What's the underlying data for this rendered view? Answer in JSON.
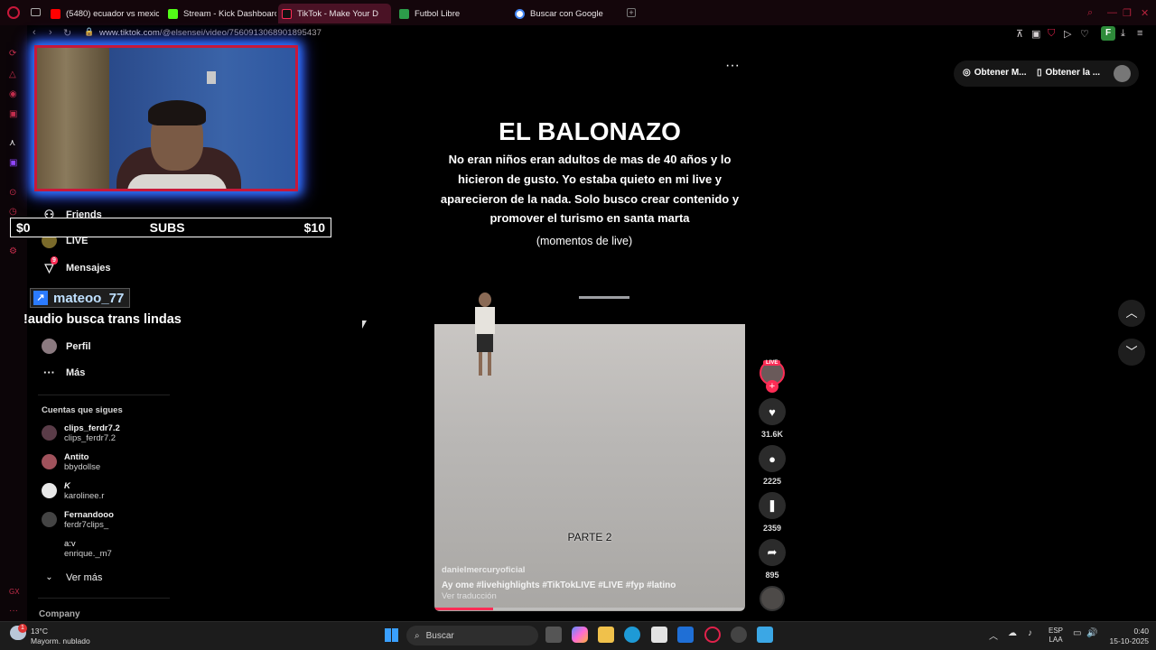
{
  "browser": {
    "tabs": [
      {
        "label": "(5480) ecuador vs mexico",
        "icon": "youtube-icon",
        "color": "#ff0000"
      },
      {
        "label": "Stream - Kick Dashboard",
        "icon": "kick-icon",
        "color": "#53fc18"
      },
      {
        "label": "TikTok - Make Your D",
        "icon": "tiktok-icon",
        "color": "#ffffff",
        "active": true
      },
      {
        "label": "Futbol Libre",
        "icon": "futbol-icon",
        "color": "#2c9c4a"
      },
      {
        "label": "Buscar con Google",
        "icon": "google-icon",
        "color": "#4285f4"
      }
    ],
    "url_host": "www.tiktok.com",
    "url_path": "/@elsensei/video/7560913068901895437",
    "profile_letter": "F"
  },
  "top_right": {
    "btn1": "Obtener M...",
    "btn2": "Obtener la ..."
  },
  "nav": {
    "friends": "Friends",
    "live": "LIVE",
    "messages": "Mensajes",
    "messages_badge": "9",
    "profile": "Perfil",
    "more": "Más",
    "following_header": "Cuentas que sigues",
    "accounts": [
      {
        "name": "clips_ferdr7.2",
        "handle": "clips_ferdr7.2"
      },
      {
        "name": "Antito",
        "handle": "bbydollse"
      },
      {
        "name": "K",
        "handle": "karolinee.r"
      },
      {
        "name": "Fernandooo",
        "handle": "ferdr7clips_"
      },
      {
        "name": "a:v",
        "handle": "enrique._m7"
      }
    ],
    "see_more": "Ver más",
    "company": "Company"
  },
  "overlay": {
    "subs_left": "$0",
    "subs_center": "SUBS",
    "subs_right": "$10",
    "chat_user": "mateoo_77",
    "chat_message": "!audio busca trans lindas"
  },
  "video": {
    "title": "EL BALONAZO",
    "body_lines": [
      "No eran niños eran adultos de mas de 40 años y lo",
      "hicieron de gusto. Yo estaba quieto en mi live y",
      "aparecieron de la nada. Solo busco crear contenido y",
      "promover el turismo en santa marta"
    ],
    "subtitle": "(momentos de live)",
    "part": "PARTE 2",
    "author": "danielmercuryoficial",
    "caption": "Ay ome #livehighlights #TikTokLIVE #LIVE #fyp #latino",
    "translate": "Ver traducción",
    "progress": 0.19
  },
  "actions": {
    "live_badge": "LIVE",
    "likes": "31.6K",
    "comments": "2225",
    "saves": "2359",
    "shares": "895"
  },
  "taskbar": {
    "weather_temp": "13°C",
    "weather_desc": "Mayorm. nublado",
    "search_placeholder": "Buscar",
    "lang1": "ESP",
    "lang2": "LAA",
    "time": "0:40",
    "date": "15-10-2025",
    "weather_badge": "1"
  },
  "colors": {
    "accent": "#c8183a",
    "tiktok_red": "#fe2c55",
    "glow": "#2b7bff"
  }
}
